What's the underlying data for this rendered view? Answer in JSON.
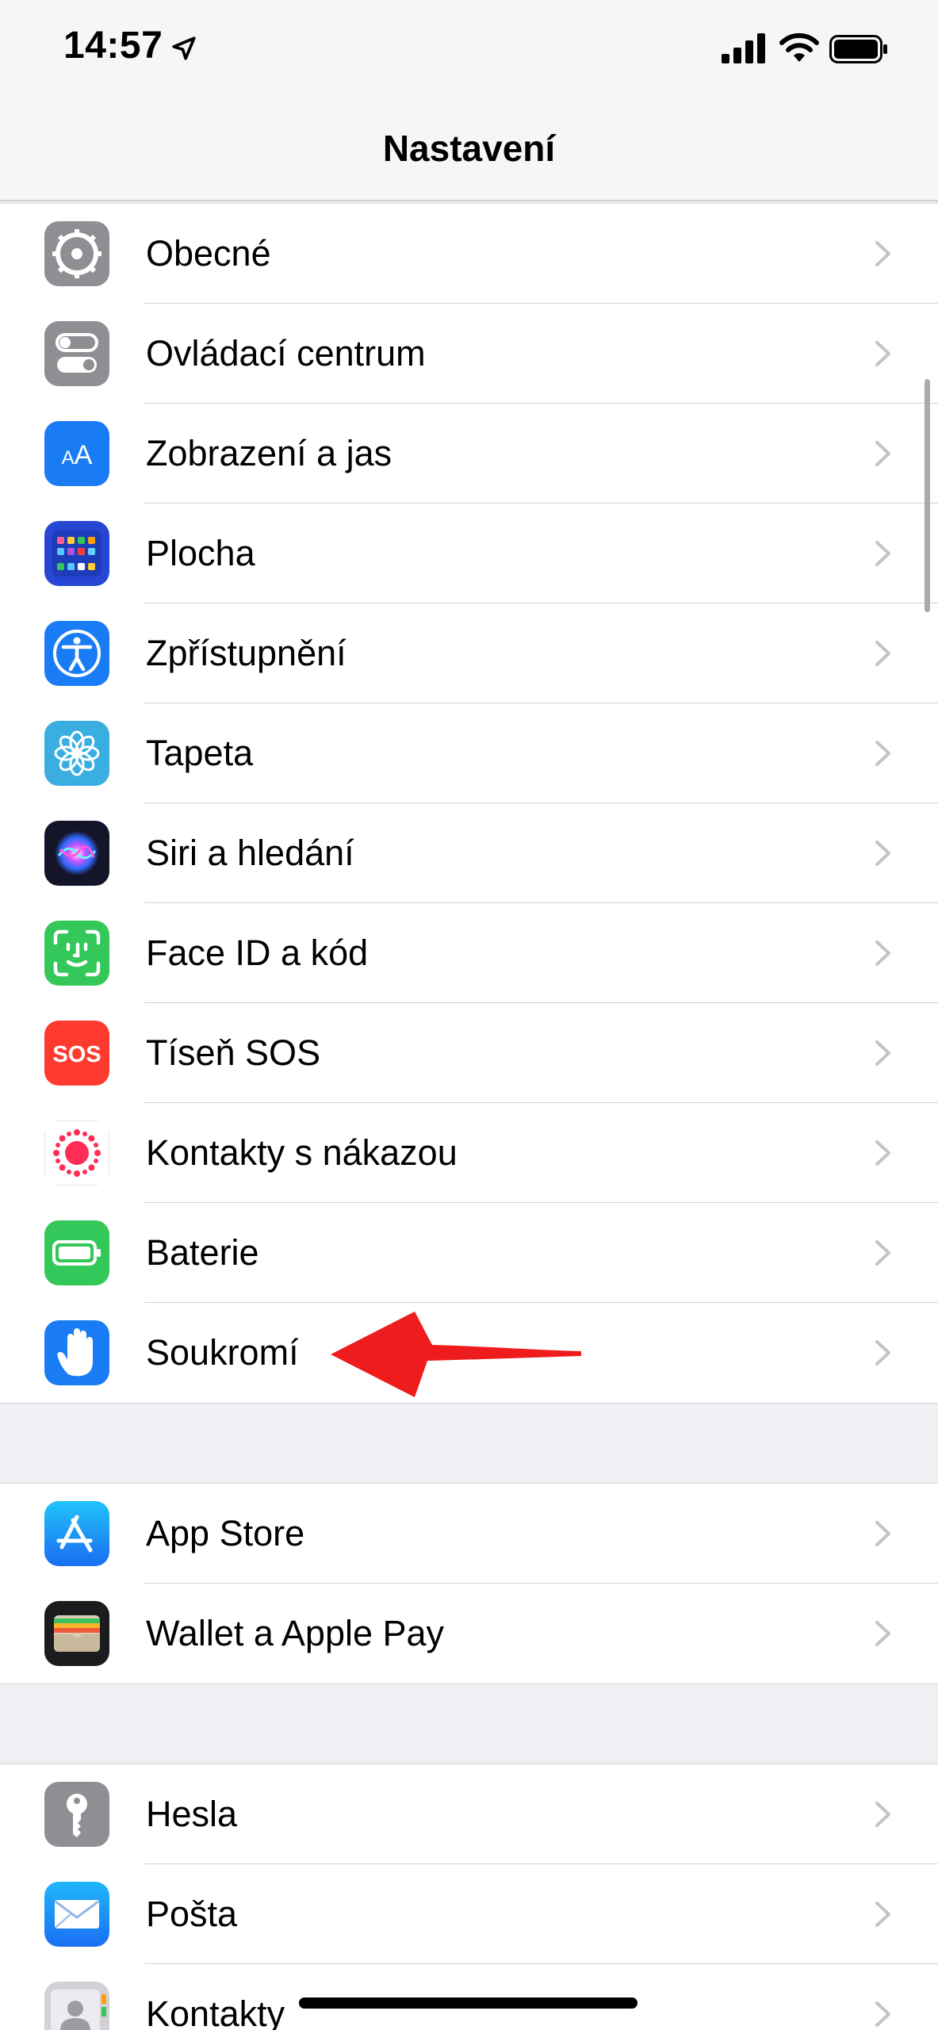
{
  "status_bar": {
    "time": "14:57",
    "icons": [
      "location-arrow-icon",
      "cellular-signal-icon",
      "wifi-icon",
      "battery-icon"
    ]
  },
  "nav": {
    "title": "Nastavení"
  },
  "sections": [
    {
      "items": [
        {
          "label": "Obecné",
          "icon": "gear-icon",
          "color": "#8e8e93"
        },
        {
          "label": "Ovládací centrum",
          "icon": "control-center-icon",
          "color": "#8e8e93"
        },
        {
          "label": "Zobrazení a jas",
          "icon": "display-brightness-icon",
          "color": "#1a7cf5"
        },
        {
          "label": "Plocha",
          "icon": "home-screen-icon",
          "color": "#2846d4"
        },
        {
          "label": "Zpřístupnění",
          "icon": "accessibility-icon",
          "color": "#1a7cf5"
        },
        {
          "label": "Tapeta",
          "icon": "wallpaper-flower-icon",
          "color": "#3aaee0"
        },
        {
          "label": "Siri a hledání",
          "icon": "siri-icon",
          "color": "#15152a"
        },
        {
          "label": "Face ID a kód",
          "icon": "face-id-icon",
          "color": "#34c759"
        },
        {
          "label": "Tíseň SOS",
          "icon": "sos-icon",
          "color": "#ff3b30"
        },
        {
          "label": "Kontakty s nákazou",
          "icon": "exposure-notification-icon",
          "color": "#ff2d55"
        },
        {
          "label": "Baterie",
          "icon": "battery-setting-icon",
          "color": "#34c759"
        },
        {
          "label": "Soukromí",
          "icon": "privacy-hand-icon",
          "color": "#1a7cf5"
        }
      ]
    },
    {
      "items": [
        {
          "label": "App Store",
          "icon": "app-store-icon",
          "color": "#1a8cf5"
        },
        {
          "label": "Wallet a Apple Pay",
          "icon": "wallet-icon",
          "color": "#1c1c1e"
        }
      ]
    },
    {
      "items": [
        {
          "label": "Hesla",
          "icon": "key-icon",
          "color": "#8e8e93"
        },
        {
          "label": "Pošta",
          "icon": "mail-icon",
          "color": "#1a8cf5"
        },
        {
          "label": "Kontakty",
          "icon": "contacts-icon",
          "color": "#c7c7cc"
        }
      ]
    }
  ],
  "annotation": {
    "type": "red-arrow",
    "points_to": "Soukromí",
    "color": "#ee1c1c"
  }
}
